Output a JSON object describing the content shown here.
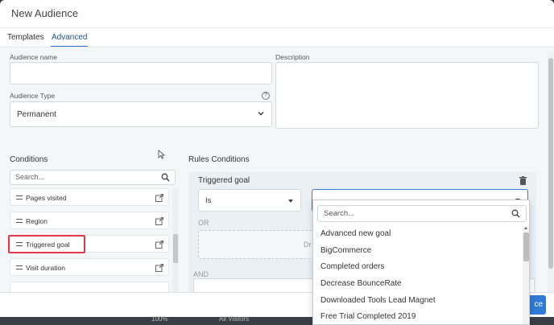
{
  "modal": {
    "title": "New Audience"
  },
  "tabs": [
    {
      "label": "Templates"
    },
    {
      "label": "Advanced"
    }
  ],
  "form": {
    "audience_name_label": "Audience name",
    "audience_name_value": "",
    "description_label": "Description",
    "description_value": "",
    "audience_type_label": "Audience Type",
    "audience_type_value": "Permanent"
  },
  "conditions": {
    "title": "Conditions",
    "search_placeholder": "Search...",
    "items": [
      {
        "label": "Pages visited"
      },
      {
        "label": "Region"
      },
      {
        "label": "Triggered goal"
      },
      {
        "label": "Visit duration"
      }
    ],
    "highlighted_item": "Triggered goal"
  },
  "rules": {
    "title": "Rules Conditions",
    "rule_title": "Triggered goal",
    "operator_value": "Is",
    "goal_value": "",
    "or_label": "OR",
    "drop_hint": "Dr",
    "and_label": "AND"
  },
  "goal_dropdown": {
    "search_placeholder": "Search...",
    "options": [
      {
        "label": "Advanced new goal"
      },
      {
        "label": "BigCommerce"
      },
      {
        "label": "Completed orders"
      },
      {
        "label": "Decrease BounceRate"
      },
      {
        "label": "Downloaded Tools Lead Magnet"
      },
      {
        "label": "Free Trial Completed 2019"
      }
    ]
  },
  "footer": {
    "primary_label_partial": "ce"
  },
  "background": {
    "zoom_text": "100%",
    "visitors_text": "All Visitors"
  },
  "colors": {
    "accent": "#2f7ad6",
    "highlight": "#e03a4a",
    "panel": "#eaf0f4"
  },
  "icons": [
    "help-icon",
    "chevron-down-icon",
    "search-icon",
    "drag-handle-icon",
    "open-external-icon",
    "trash-icon",
    "mouse-cursor-icon"
  ]
}
